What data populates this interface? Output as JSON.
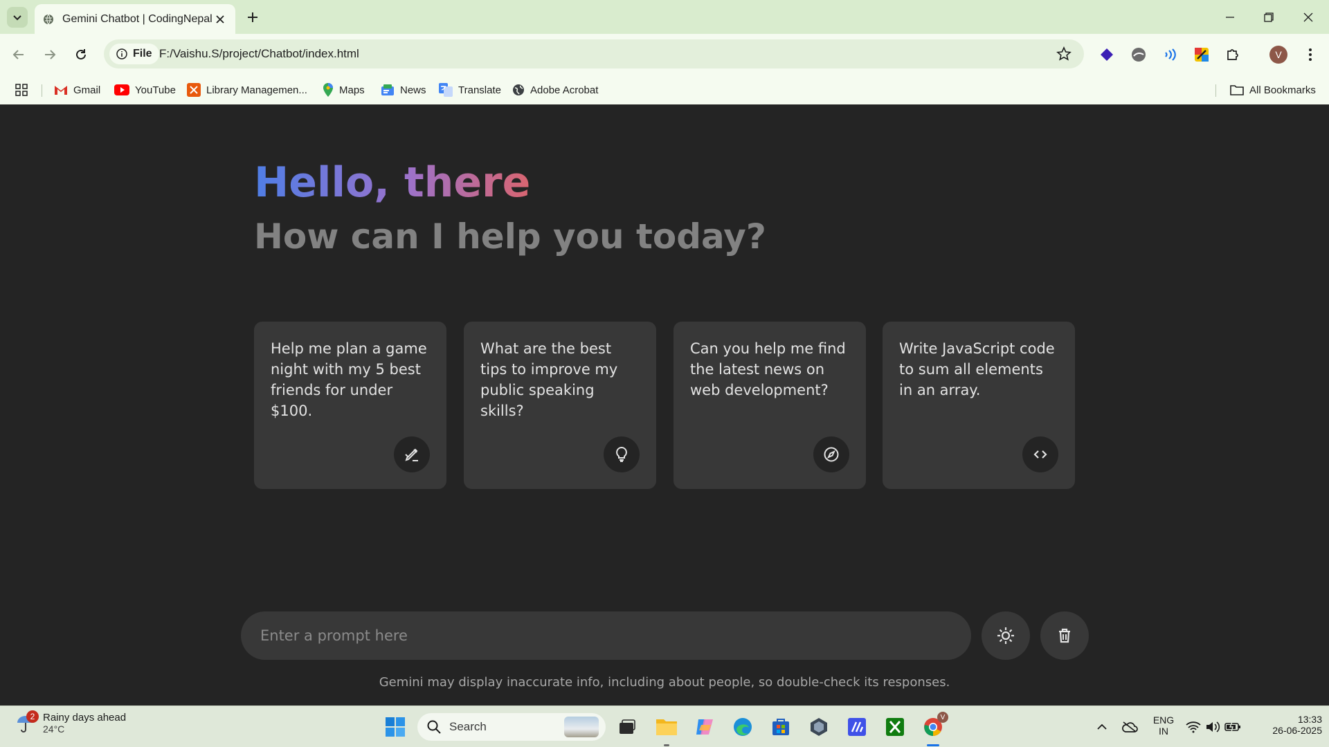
{
  "browser": {
    "tab_title": "Gemini Chatbot | CodingNepal",
    "site_chip": "File",
    "url": "F:/Vaishu.S/project/Chatbot/index.html",
    "profile_initial": "V",
    "bookmarks": [
      {
        "label": "Gmail",
        "icon": "gmail-icon"
      },
      {
        "label": "YouTube",
        "icon": "youtube-icon"
      },
      {
        "label": "Library Managemen...",
        "icon": "library-icon"
      },
      {
        "label": "Maps",
        "icon": "maps-icon"
      },
      {
        "label": "News",
        "icon": "news-icon"
      },
      {
        "label": "Translate",
        "icon": "translate-icon"
      },
      {
        "label": "Adobe Acrobat",
        "icon": "globe-icon"
      }
    ],
    "all_bookmarks": "All Bookmarks"
  },
  "page": {
    "greeting": "Hello, there",
    "subtitle": "How can I help you today?",
    "suggestions": [
      {
        "text": "Help me plan a game night with my 5 best friends for under $100.",
        "icon": "draw-icon"
      },
      {
        "text": "What are the best tips to improve my public speaking skills?",
        "icon": "lightbulb-icon"
      },
      {
        "text": "Can you help me find the latest news on web development?",
        "icon": "explore-icon"
      },
      {
        "text": "Write JavaScript code to sum all elements in an array.",
        "icon": "code-icon"
      }
    ],
    "prompt_placeholder": "Enter a prompt here",
    "disclaimer": "Gemini may display inaccurate info, including about people, so double-check its responses.",
    "colors": {
      "background": "#242424",
      "card": "#383838",
      "gradient_start": "#4f7ee6",
      "gradient_end": "#d96570"
    }
  },
  "taskbar": {
    "weather_badge": "2",
    "weather_title": "Rainy days ahead",
    "weather_temp": "24°C",
    "search_label": "Search",
    "lang_top": "ENG",
    "lang_bottom": "IN",
    "time": "13:33",
    "date": "26-06-2025"
  }
}
